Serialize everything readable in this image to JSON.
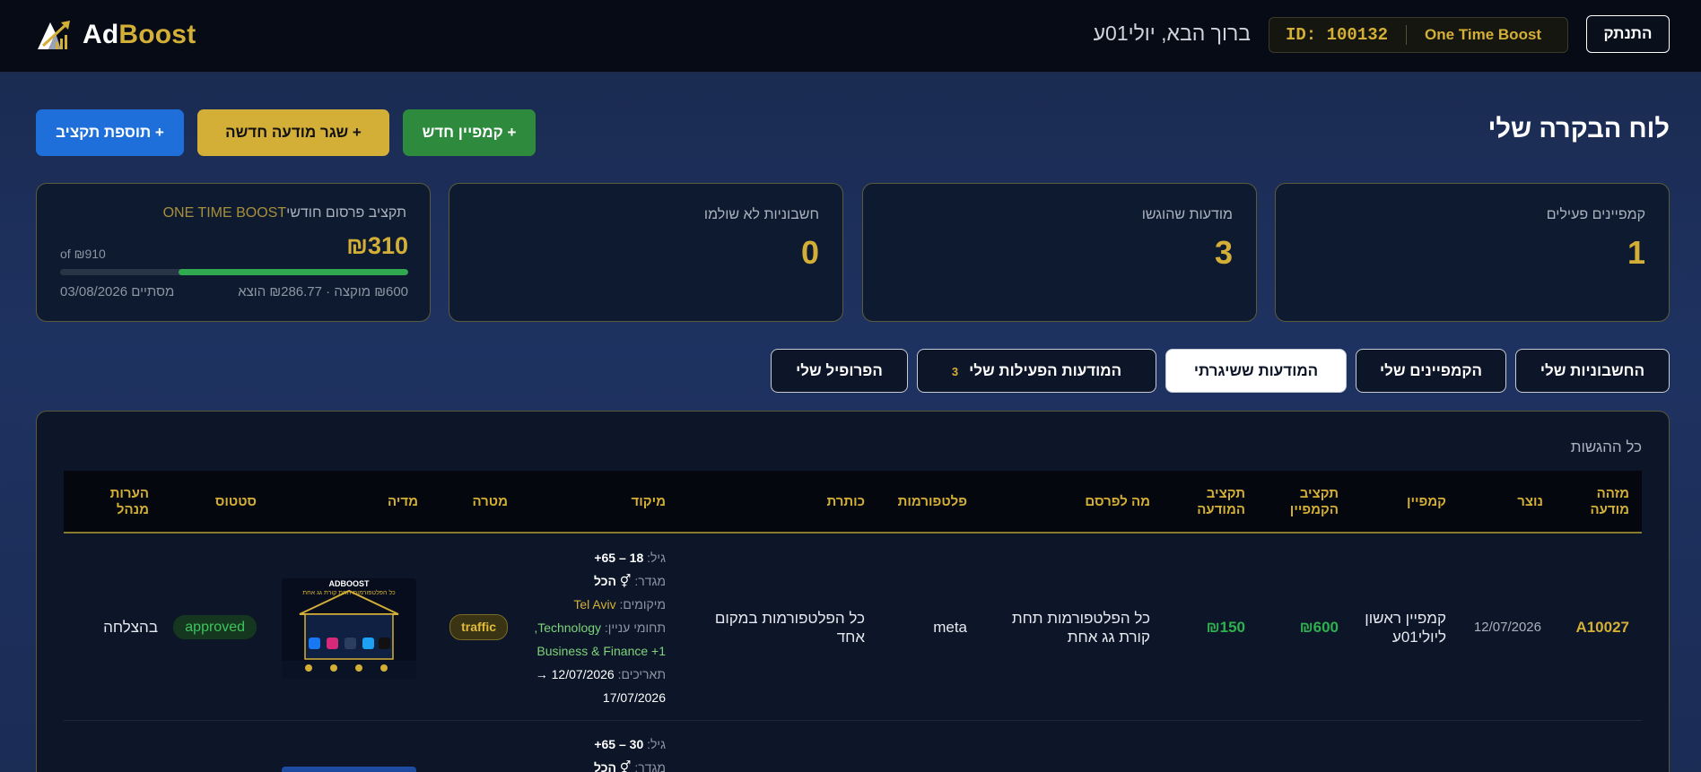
{
  "header": {
    "logo_ad": "Ad",
    "logo_boost": "Boost",
    "logout_label": "התנתק",
    "id_label": "ID: 100132",
    "plan_label": "One Time Boost",
    "welcome_text": "ברוך הבא, יולי01ע"
  },
  "dashboard": {
    "title": "לוח הבקרה שלי",
    "new_campaign_label": "+ קמפיין חדש",
    "new_ad_label": "+ שגר מודעה חדשה",
    "add_budget_label": "+ תוספת תקציב"
  },
  "stats": {
    "active_campaigns_label": "קמפיינים פעילים",
    "active_campaigns_value": "1",
    "submitted_ads_label": "מודעות שהוגשו",
    "submitted_ads_value": "3",
    "unpaid_invoices_label": "חשבוניות לא שולמו",
    "unpaid_invoices_value": "0",
    "budget": {
      "label": "תקציב פרסום חודשי",
      "plan": "ONE TIME BOOST",
      "amount": "₪310",
      "of_total": "of ₪910",
      "progress_fraction": 0.66,
      "allocated_spent": "₪600 מוקצה · ₪286.77 הוצא",
      "ends": "מסתיים 03/08/2026"
    }
  },
  "tabs": [
    {
      "label": "החשבוניות שלי"
    },
    {
      "label": "הקמפיינים שלי"
    },
    {
      "label": "המודעות ששיגרתי",
      "active": true
    },
    {
      "label": "המודעות הפעילות שלי",
      "count": "3"
    },
    {
      "label": "הפרופיל שלי"
    }
  ],
  "table": {
    "title": "כל ההגשות",
    "columns": [
      "מזהה מודעה",
      "נוצר",
      "קמפיין",
      "תקציב הקמפיין",
      "תקציב המודעה",
      "מה לפרסם",
      "פלטפורמות",
      "כותרת",
      "מיקוד",
      "מטרה",
      "מדיה",
      "סטטוס",
      "הערות מנהל"
    ],
    "rows": [
      {
        "id": "A10027",
        "created": "12/07/2026",
        "campaign": "קמפיין ראשון ליולי01ע",
        "campaign_budget": "₪600",
        "ad_budget": "₪150",
        "what": "כל הפלטפורמות תחת קורת גג אחת",
        "platforms": "meta",
        "headline": "כל הפלטפורמות במקום אחד",
        "targeting": {
          "age_key": "גיל:",
          "age": "18 – 65+",
          "gender_key": "מגדר:",
          "gender": "⚥ הכל",
          "locations_key": "מיקומים:",
          "locations": "Tel Aviv",
          "interests_key": "תחומי עניין:",
          "interests_1": "Technology,",
          "interests_2": "Business & Finance +1",
          "dates_key": "תאריכים:",
          "dates_start": "12/07/2026 →",
          "dates_end": "17/07/2026"
        },
        "goal": "traffic",
        "media_brand": "ADBOOST",
        "media_caption": "כל הפלטפורמות תחת קורת גג אחת",
        "status": "approved",
        "admin_notes": "בהצלחה"
      },
      {
        "targeting": {
          "age_key": "גיל:",
          "age": "30 – 65+",
          "gender_key": "מגדר:",
          "gender": "⚥ הכל"
        }
      }
    ]
  },
  "colors": {
    "accent_gold": "#d4af37",
    "success_green": "#2e8b3e",
    "primary_blue": "#1e6fd9",
    "page_bg": "#1e3261",
    "topbar_bg": "#060b16"
  }
}
